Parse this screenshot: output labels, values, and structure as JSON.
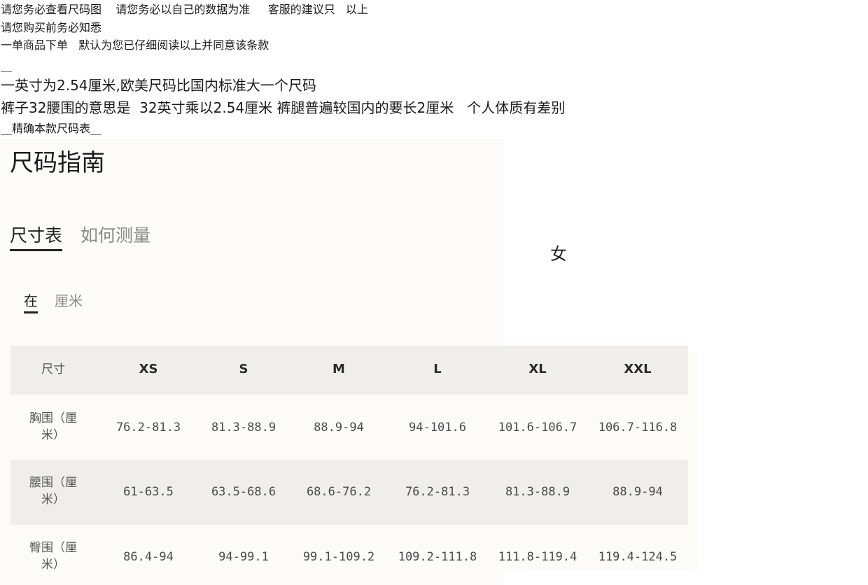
{
  "notices": {
    "line1": "请您务必查看尺码图    请您务必以自己的数据为准     客服的建议只   以上",
    "line2": "请您购买前务必知悉",
    "line3": "一单商品下单   默认为您已仔细阅读以上并同意该条款",
    "line4": "__",
    "line5": "一英寸为2.54厘米,欧美尺码比国内标准大一个尺码",
    "line6": "裤子32腰围的意思是  32英寸乘以2.54厘米 裤腿普遍较国内的要长2厘米   个人体质有差别",
    "line7": "__精确本款尺码表__"
  },
  "guide": {
    "title": "尺码指南",
    "tabs": [
      "尺寸表",
      "如何测量"
    ],
    "units": [
      "在",
      "厘米"
    ],
    "gender": "女"
  },
  "table": {
    "header": [
      "尺寸",
      "XS",
      "S",
      "M",
      "L",
      "XL",
      "XXL"
    ],
    "rows": [
      {
        "label": "胸围（厘\n米）",
        "values": [
          "76.2-81.3",
          "81.3-88.9",
          "88.9-94",
          "94-101.6",
          "101.6-106.7",
          "106.7-116.8"
        ]
      },
      {
        "label": "腰围（厘\n米）",
        "values": [
          "61-63.5",
          "63.5-68.6",
          "68.6-76.2",
          "76.2-81.3",
          "81.3-88.9",
          "88.9-94"
        ]
      },
      {
        "label": "臀围（厘\n米）",
        "values": [
          "86.4-94",
          "94-99.1",
          "99.1-109.2",
          "109.2-111.8",
          "111.8-119.4",
          "119.4-124.5"
        ]
      }
    ]
  }
}
